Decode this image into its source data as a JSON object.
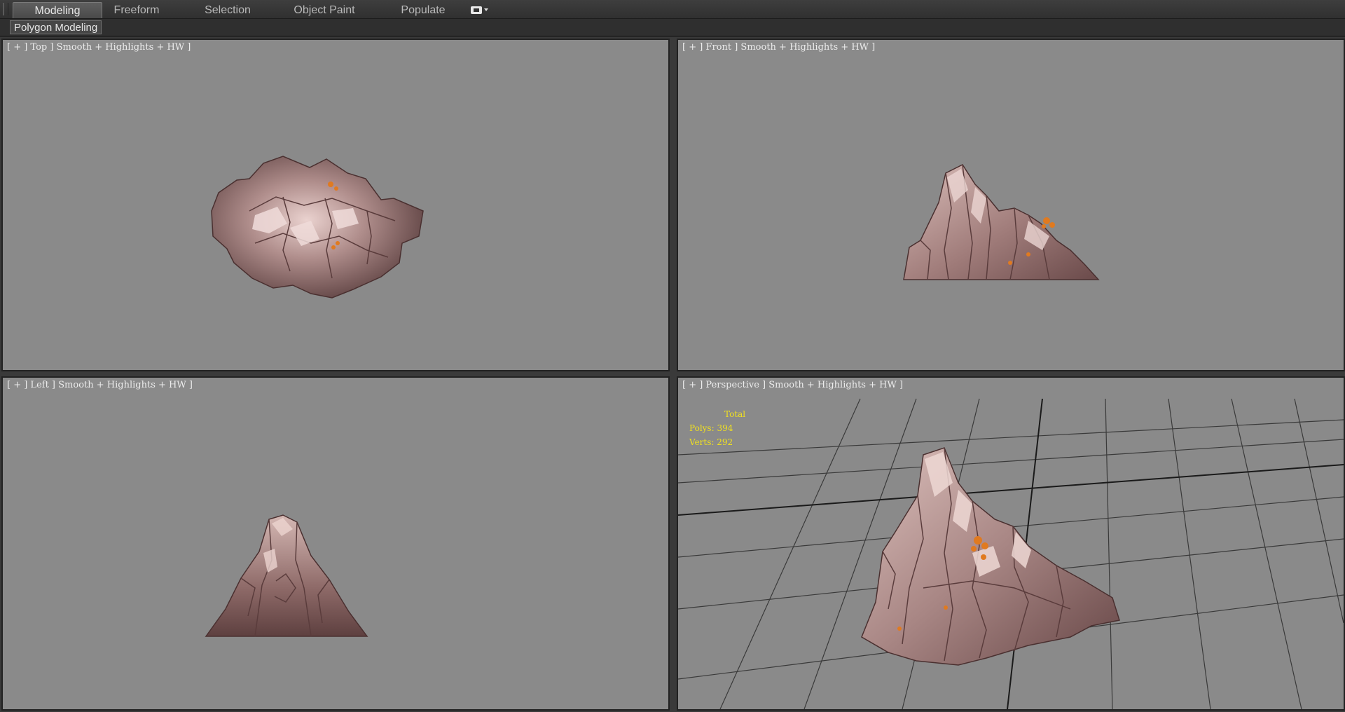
{
  "ribbon": {
    "tabs": [
      {
        "label": "Modeling",
        "active": true
      },
      {
        "label": "Freeform",
        "active": false
      },
      {
        "label": "Selection",
        "active": false
      },
      {
        "label": "Object Paint",
        "active": false
      },
      {
        "label": "Populate",
        "active": false
      }
    ],
    "options_icon": "ribbon-options-icon",
    "panel_label": "Polygon Modeling"
  },
  "viewports": {
    "top": {
      "label": "[ + ] Top ] Smooth + Highlights + HW ]"
    },
    "front": {
      "label": "[ + ] Front ] Smooth + Highlights + HW ]"
    },
    "left": {
      "label": "[ + ] Left ] Smooth + Highlights + HW ]"
    },
    "perspective": {
      "label": "[ + ] Perspective ] Smooth + Highlights + HW ]"
    }
  },
  "stats": {
    "title": "Total",
    "polys": "Polys: 394",
    "verts": "Verts: 292"
  },
  "colors": {
    "viewport_bg": "#8a8a8a",
    "rock_base": "#9c7a7a",
    "rock_light": "#d7b6b4",
    "rock_dark": "#5a3e3e",
    "moss_accent": "#e07a20",
    "stats_text": "#f0e020"
  }
}
